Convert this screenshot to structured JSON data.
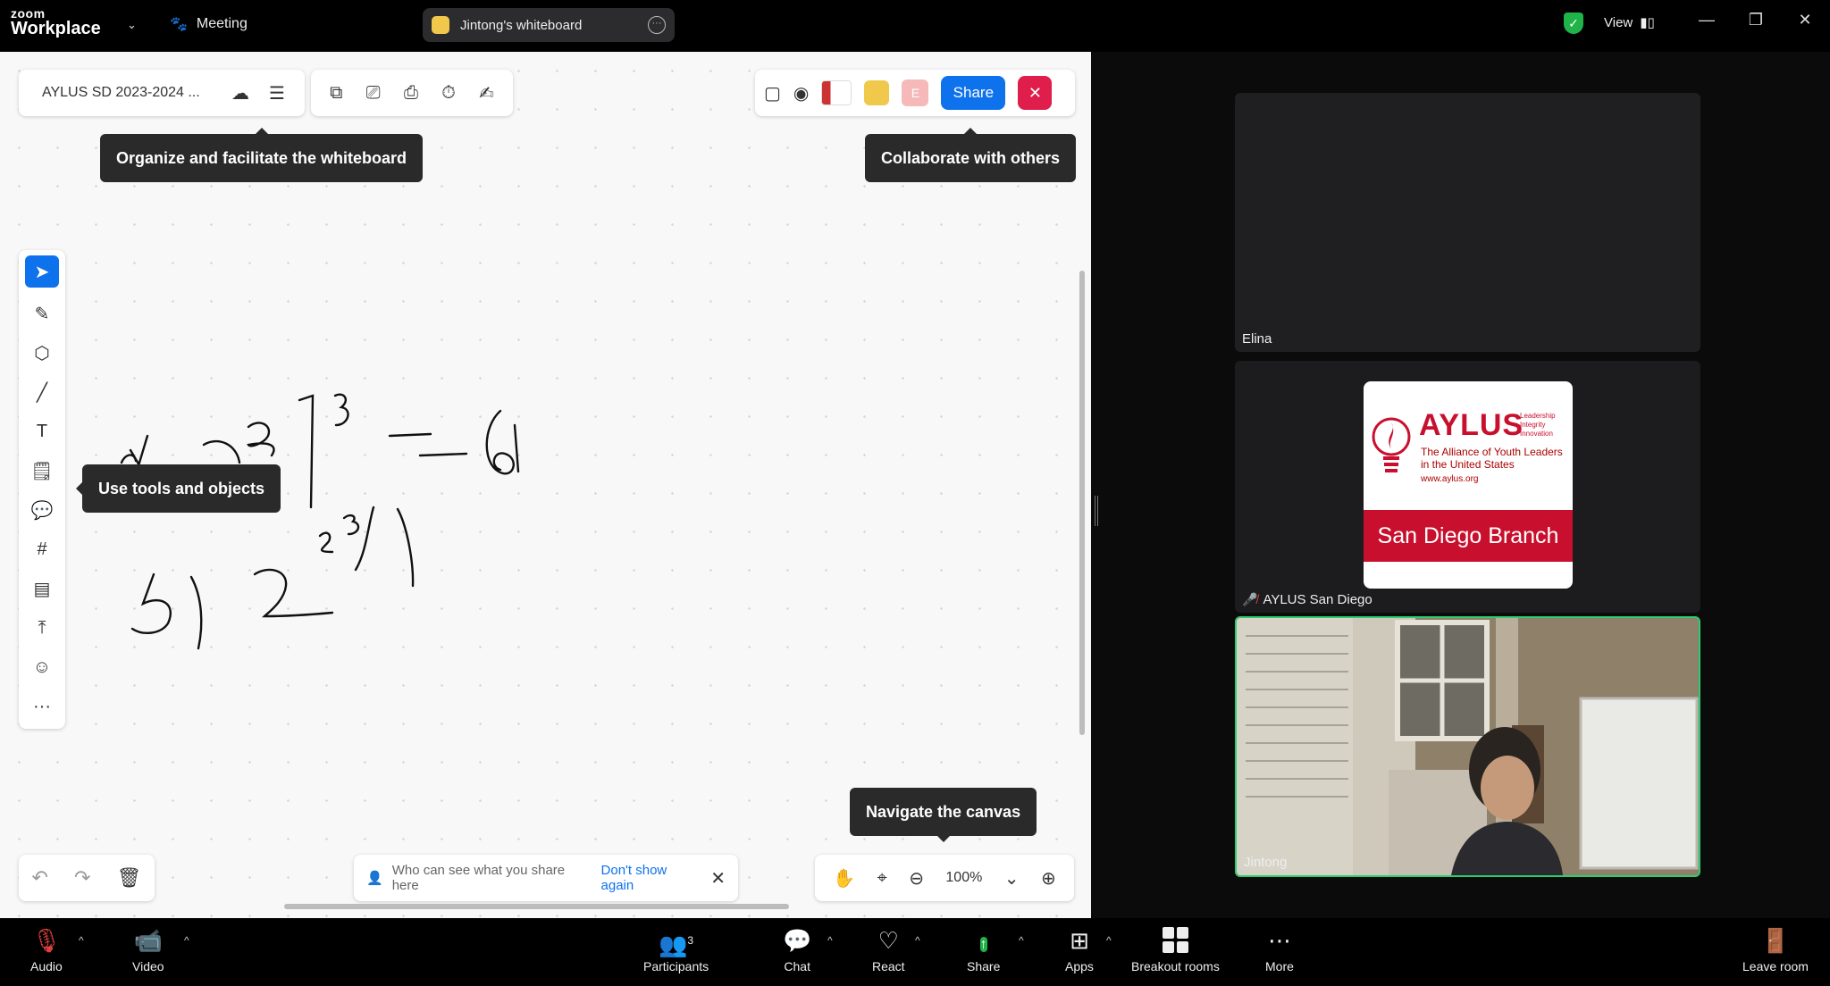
{
  "app": {
    "logo_small": "zoom",
    "logo_big": "Workplace",
    "meeting_label": "Meeting"
  },
  "whiteboard_tab": {
    "title": "Jintong's whiteboard",
    "more": "···"
  },
  "view_label": "View",
  "board": {
    "title": "AYLUS SD 2023-2024 ...",
    "share_label": "Share",
    "close_label": "✕",
    "collab_avatar_initial": "E",
    "tips": {
      "organize": "Organize and facilitate the whiteboard",
      "collaborate": "Collaborate with others",
      "tools": "Use tools and objects",
      "navigate": "Navigate the canvas"
    },
    "info_text": "Who can see what you share here",
    "info_link": "Don't show again",
    "zoom_level": "100%"
  },
  "tiles": {
    "elina": "Elina",
    "aylus": "AYLUS San Diego",
    "jintong": "Jintong"
  },
  "aylus_logo": {
    "brand": "AYLUS",
    "tagline": [
      "Leadership",
      "Integrity",
      "Innovation"
    ],
    "sub1": "The Alliance of Youth Leaders",
    "sub2": "in the United States",
    "web": "www.aylus.org",
    "branch": "San Diego Branch"
  },
  "toolbar": {
    "audio": "Audio",
    "video": "Video",
    "participants": "Participants",
    "participants_count": "3",
    "chat": "Chat",
    "react": "React",
    "share": "Share",
    "apps": "Apps",
    "breakout": "Breakout rooms",
    "more": "More",
    "leave": "Leave room"
  },
  "colors": {
    "accent": "#0e72ed",
    "danger": "#e01e4b",
    "aylus_red": "#c8102e",
    "active_speaker": "#2ecc71"
  }
}
